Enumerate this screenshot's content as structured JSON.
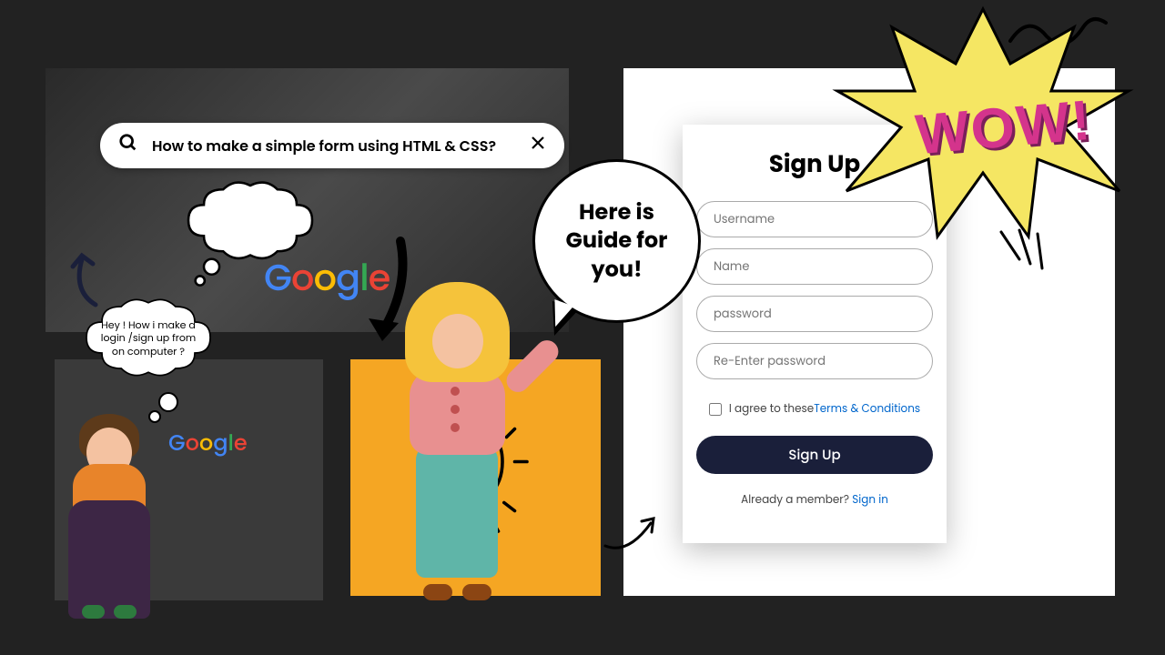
{
  "search": {
    "query": "How to make a simple form using HTML & CSS?"
  },
  "thought1": "Hey ! How i make a login /sign up from on computer ?",
  "bubble_guide": "Here is Guide for you!",
  "form": {
    "title": "Sign Up",
    "username": "Username",
    "name": "Name",
    "password": "password",
    "repassword": "Re-Enter password",
    "agree_prefix": "I agree to these ",
    "terms": "Terms & Conditions",
    "button": "Sign Up",
    "footer_prefix": "Already a member? ",
    "signin": "Sign in"
  },
  "wow": "WOW!",
  "google": "Google"
}
